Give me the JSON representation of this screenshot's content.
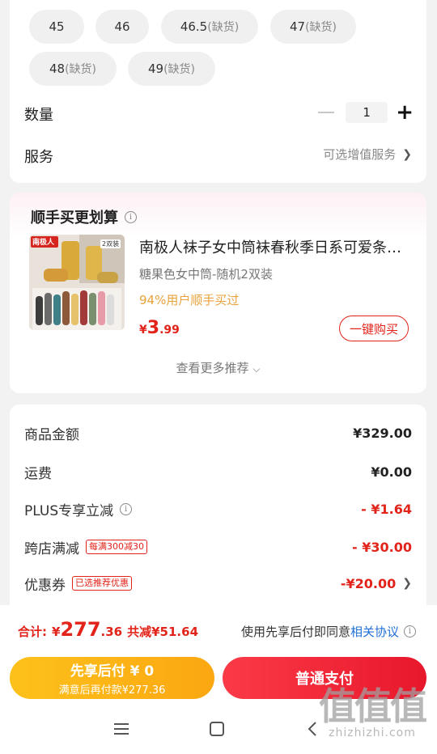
{
  "size_options": {
    "rows": [
      [
        {
          "size": "45",
          "note": ""
        },
        {
          "size": "46",
          "note": ""
        },
        {
          "size": "46.5",
          "note": "(缺货)"
        },
        {
          "size": "47",
          "note": "(缺货)"
        }
      ],
      [
        {
          "size": "48",
          "note": "(缺货)"
        },
        {
          "size": "49",
          "note": "(缺货)"
        }
      ]
    ]
  },
  "quantity": {
    "label": "数量",
    "value": "1",
    "minus_icon": "minus-icon",
    "plus_icon": "plus-icon"
  },
  "service": {
    "label": "服务",
    "value": "可选增值服务"
  },
  "recommend": {
    "title": "顺手买更划算",
    "product": {
      "name": "南极人袜子女中筒袜春秋季日系可爱条纹堆堆袜",
      "variant": "糖果色女中筒-随机2双装",
      "stat": "94%用户顺手买过",
      "price_symbol": "¥",
      "price_int": "3",
      "price_dec": ".99",
      "buy_label": "一键购买",
      "thumb_brand": "南极人",
      "thumb_badge": "2双装"
    },
    "more_label": "查看更多推荐"
  },
  "price_summary": {
    "rows": [
      {
        "label": "商品金额",
        "value": "¥329.00",
        "tag": ""
      },
      {
        "label": "运费",
        "value": "¥0.00",
        "tag": ""
      },
      {
        "label": "PLUS专享立减",
        "value": "- ¥1.64",
        "tag": ""
      },
      {
        "label": "跨店满减",
        "value": "- ¥30.00",
        "tag": "每满300减30"
      },
      {
        "label": "优惠券",
        "value": "-¥20.00",
        "tag": "已选推荐优惠"
      }
    ]
  },
  "bottom": {
    "total_label": "合计:",
    "total_symbol": "¥",
    "total_int": "277",
    "total_dec": ".36",
    "saved": "共减¥51.64",
    "agree_text": "使用先享后付即同意",
    "agree_link": "相关协议",
    "pay_later_title": "先享后付 ¥ 0",
    "pay_later_sub": "满意后再付款¥277.36",
    "pay_now": "普通支付"
  },
  "watermark": {
    "big": "值值值",
    "small": "zhizhizhi.com"
  },
  "colors": {
    "accent": "#e2231a",
    "orange": "#fdc11b",
    "link": "#1f6fd6"
  }
}
